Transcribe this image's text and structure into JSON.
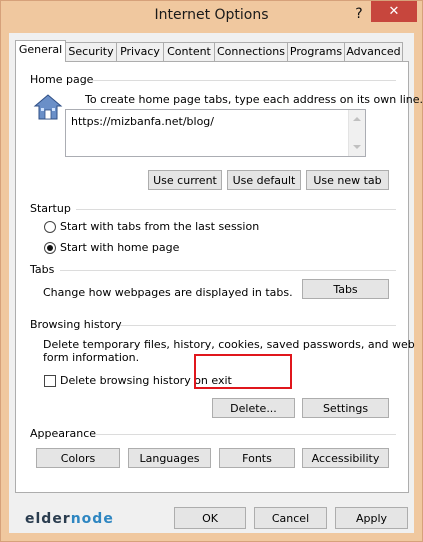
{
  "window": {
    "title": "Internet Options",
    "help_label": "?",
    "close_label": "✕"
  },
  "tabs": [
    {
      "label": "General"
    },
    {
      "label": "Security"
    },
    {
      "label": "Privacy"
    },
    {
      "label": "Content"
    },
    {
      "label": "Connections"
    },
    {
      "label": "Programs"
    },
    {
      "label": "Advanced"
    }
  ],
  "home_page": {
    "group_label": "Home page",
    "description": "To create home page tabs, type each address on its own line.",
    "address": "https://mizbanfa.net/blog/",
    "buttons": {
      "use_current": "Use current",
      "use_default": "Use default",
      "use_new_tab": "Use new tab"
    }
  },
  "startup": {
    "group_label": "Startup",
    "option_last_session": "Start with tabs from the last session",
    "option_home_page": "Start with home page",
    "selected": "option_home_page"
  },
  "tabs_group": {
    "group_label": "Tabs",
    "description": "Change how webpages are displayed in tabs.",
    "button": "Tabs"
  },
  "browsing_history": {
    "group_label": "Browsing history",
    "description_line1": "Delete temporary files, history, cookies, saved passwords, and web",
    "description_line2": "form information.",
    "checkbox_label": "Delete browsing history on exit",
    "checkbox_checked": false,
    "delete_button": "Delete...",
    "settings_button": "Settings"
  },
  "appearance": {
    "group_label": "Appearance",
    "colors": "Colors",
    "languages": "Languages",
    "fonts": "Fonts",
    "accessibility": "Accessibility"
  },
  "footer": {
    "logo_main": "elder",
    "logo_accent": "node",
    "ok": "OK",
    "cancel": "Cancel",
    "apply": "Apply"
  },
  "colors": {
    "title_bar": "#f0c89f",
    "close_button": "#c7463d",
    "highlight": "#e0161c"
  }
}
